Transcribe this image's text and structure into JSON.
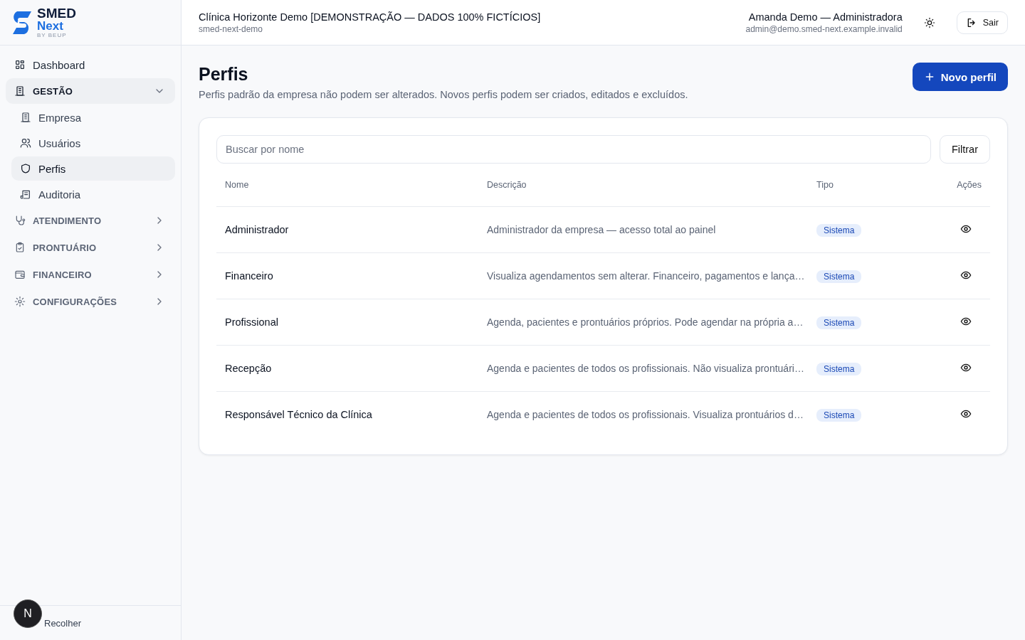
{
  "brand": {
    "name": "SMED",
    "product": "Next",
    "tagline": "BY BEUP"
  },
  "header": {
    "clinic": "Clínica Horizonte Demo [DEMONSTRAÇÃO — DADOS 100% FICTÍCIOS]",
    "slug": "smed-next-demo",
    "user": "Amanda Demo — Administradora",
    "email": "admin@demo.smed-next.example.invalid",
    "logout": "Sair"
  },
  "sidebar": {
    "items": [
      {
        "kind": "link",
        "label": "Dashboard",
        "selected": false
      },
      {
        "kind": "section",
        "label": "GESTÃO",
        "expanded": true,
        "children": [
          {
            "label": "Empresa",
            "selected": false
          },
          {
            "label": "Usuários",
            "selected": false
          },
          {
            "label": "Perfis",
            "selected": true
          },
          {
            "label": "Auditoria",
            "selected": false
          }
        ]
      },
      {
        "kind": "section",
        "label": "ATENDIMENTO",
        "expanded": false
      },
      {
        "kind": "section",
        "label": "PRONTUÁRIO",
        "expanded": false
      },
      {
        "kind": "section",
        "label": "FINANCEIRO",
        "expanded": false
      },
      {
        "kind": "section",
        "label": "CONFIGURAÇÕES",
        "expanded": false
      }
    ],
    "collapse": "Recolher",
    "avatar": "N"
  },
  "page": {
    "title": "Perfis",
    "subtitle": "Perfis padrão da empresa não podem ser alterados. Novos perfis podem ser criados, editados e excluídos.",
    "new_button": "Novo perfil"
  },
  "search": {
    "placeholder": "Buscar por nome"
  },
  "filter_button": "Filtrar",
  "table": {
    "columns": [
      "Nome",
      "Descrição",
      "Tipo",
      "Ações"
    ],
    "rows": [
      {
        "name": "Administrador",
        "description": "Administrador da empresa — acesso total ao painel",
        "type": "Sistema"
      },
      {
        "name": "Financeiro",
        "description": "Visualiza agendamentos sem alterar. Financeiro, pagamentos e lança…",
        "type": "Sistema"
      },
      {
        "name": "Profissional",
        "description": "Agenda, pacientes e prontuários próprios. Pode agendar na própria a…",
        "type": "Sistema"
      },
      {
        "name": "Recepção",
        "description": "Agenda e pacientes de todos os profissionais. Não visualiza prontuári…",
        "type": "Sistema"
      },
      {
        "name": "Responsável Técnico da Clínica",
        "description": "Agenda e pacientes de todos os profissionais. Visualiza prontuários d…",
        "type": "Sistema"
      }
    ]
  }
}
